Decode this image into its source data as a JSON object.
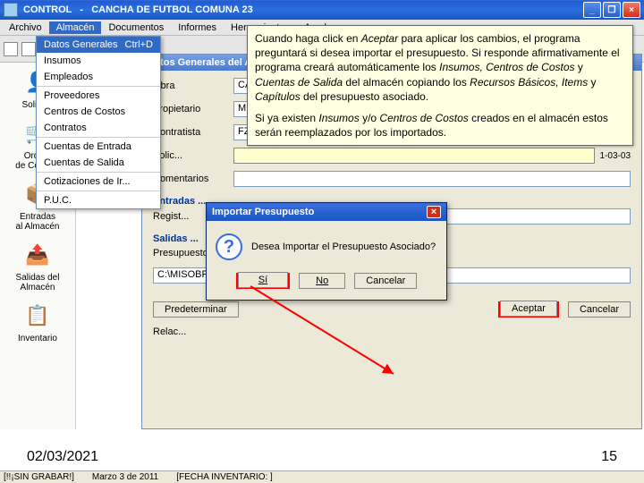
{
  "title": {
    "app": "CONTROL",
    "sep": "-",
    "doc": "CANCHA DE FUTBOL COMUNA 23"
  },
  "menu": {
    "items": [
      "Archivo",
      "Almacén",
      "Documentos",
      "Informes",
      "Herramientas",
      "Ayuda"
    ],
    "selected_index": 1
  },
  "dropdown": {
    "items": [
      {
        "label": "Datos Generales",
        "shortcut": "Ctrl+D",
        "selected": true
      },
      {
        "label": "Insumos"
      },
      {
        "label": "Empleados"
      },
      {
        "sep": true
      },
      {
        "label": "Proveedores"
      },
      {
        "label": "Centros de Costos"
      },
      {
        "label": "Contratos"
      },
      {
        "sep": true
      },
      {
        "label": "Cuentas de Entrada"
      },
      {
        "label": "Cuentas de Salida"
      },
      {
        "sep": true
      },
      {
        "label": "Cotizaciones de Ir..."
      },
      {
        "sep": true
      },
      {
        "label": "P.U.C."
      }
    ]
  },
  "side_nav": [
    {
      "icon": "👤",
      "label": "Solicit..."
    },
    {
      "icon": "🛒",
      "label": "Orde...\nde Compra"
    },
    {
      "icon": "📦",
      "label": "Entradas\nal Almacén"
    },
    {
      "icon": "📤",
      "label": "Salidas del\nAlmacén"
    },
    {
      "icon": "📋",
      "label": "Inventario"
    }
  ],
  "form": {
    "title": "Datos Generales del Alma...",
    "rows": {
      "obra_label": "Obra",
      "obra_value": "CANCHA...",
      "prop_label": "Propietario",
      "prop_value": "MUNICI...",
      "contr_label": "Contratista",
      "contr_value": "FZ CON...",
      "solic_label": "Solic...",
      "coment_label": "Comentarios",
      "entradas_hd": "Entradas ...",
      "regist_label": "Regist...",
      "salidas_hd": "Salidas ...",
      "presu_label": "Presupuesto Asociado",
      "presu_btn": ">>",
      "presu_path": "C:\\MISOBRAS\\CANCHA",
      "predet": "Predeterminar",
      "aceptar": "Aceptar",
      "cancelar": "Cancelar",
      "relac": "Relac...",
      "extra_date": "1-03-03"
    }
  },
  "dialog": {
    "title": "Importar Presupuesto",
    "msg": "Desea Importar el Presupuesto Asociado?",
    "si": "Sí",
    "no": "No",
    "cancel": "Cancelar"
  },
  "callout": {
    "p1a": "Cuando haga click en ",
    "p1b": " para aplicar los cambios, el programa preguntará si desea importar el presupuesto. Si responde afirmativamente el programa creará automáticamente los ",
    "p1c": " y ",
    "p1d": " del almacén copiando los ",
    "p1e": " y ",
    "p1f": " del presupuesto asociado.",
    "em_aceptar": "Aceptar",
    "em_insumos": "Insumos, Centros de Costos",
    "em_cuentas": "Cuentas de Salida",
    "em_recursos": "Recursos Básicos, Items",
    "em_caps": "Capítulos",
    "p2a": "Si ya existen ",
    "p2b": " y/o ",
    "p2c": " creados en el almacén estos serán reemplazados por los importados.",
    "em_insumos2": "Insumos",
    "em_cc": "Centros de Costos"
  },
  "footer": {
    "date": "02/03/2021",
    "page": "15"
  },
  "status": {
    "msg": "[!!¡SIN GRABAR!]",
    "fecha": "Marzo 3 de 2011",
    "inv": "[FECHA INVENTARIO: ]"
  }
}
